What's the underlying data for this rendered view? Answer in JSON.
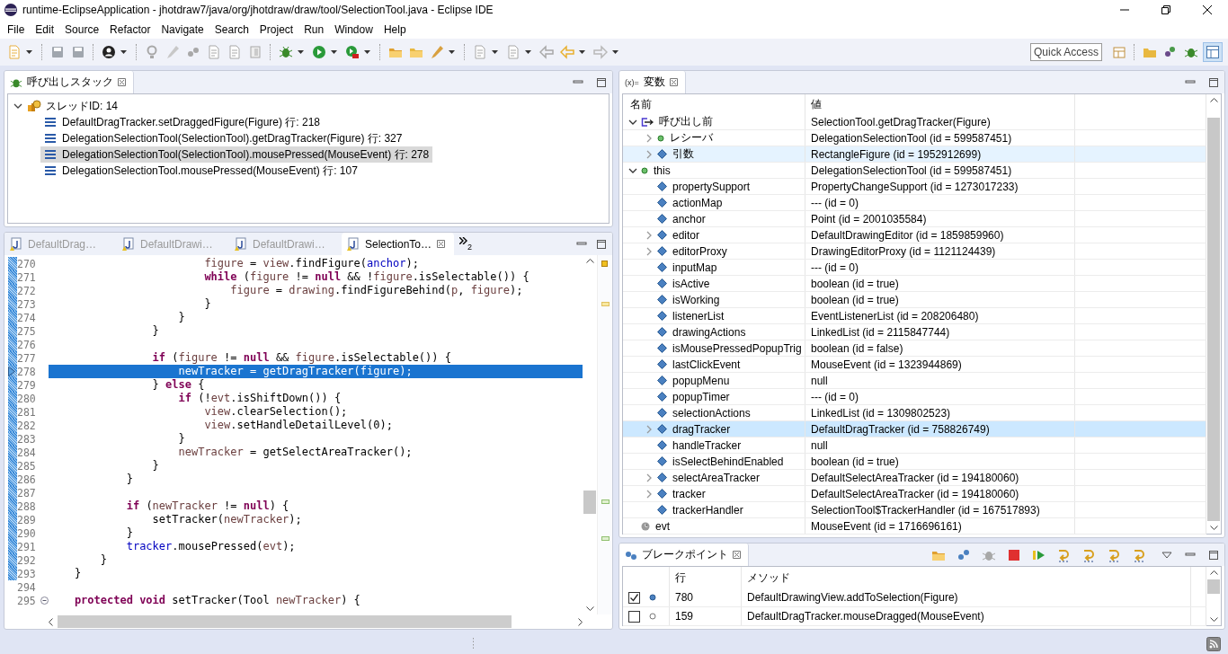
{
  "window": {
    "title": "runtime-EclipseApplication - jhotdraw7/java/org/jhotdraw/draw/tool/SelectionTool.java - Eclipse IDE"
  },
  "menu": [
    "File",
    "Edit",
    "Source",
    "Refactor",
    "Navigate",
    "Search",
    "Project",
    "Run",
    "Window",
    "Help"
  ],
  "quick_access": {
    "placeholder": "Quick Access"
  },
  "call_stack": {
    "title": "呼び出しスタック",
    "threads": [
      {
        "label": "スレッドID: 14",
        "expanded": true,
        "frames": [
          {
            "label": "DefaultDragTracker.setDraggedFigure(Figure) 行: 218",
            "selected": false
          },
          {
            "label": "DelegationSelectionTool(SelectionTool).getDragTracker(Figure) 行: 327",
            "selected": false
          },
          {
            "label": "DelegationSelectionTool(SelectionTool).mousePressed(MouseEvent) 行: 278",
            "selected": true
          },
          {
            "label": "DelegationSelectionTool.mousePressed(MouseEvent) 行: 107",
            "selected": false
          }
        ]
      }
    ]
  },
  "editor": {
    "tabs": [
      {
        "label": "DefaultDrag…",
        "selected": false
      },
      {
        "label": "DefaultDrawi…",
        "selected": false
      },
      {
        "label": "DefaultDrawi…",
        "selected": false
      },
      {
        "label": "SelectionTo…",
        "selected": true
      }
    ],
    "overflow": "2",
    "lines": [
      {
        "num": "270",
        "in_range": true,
        "tokens": [
          {
            "t": "                        figure",
            "kind": "local"
          },
          {
            "t": " = "
          },
          {
            "t": "view",
            "kind": "local"
          },
          {
            "t": ".findFigure("
          },
          {
            "t": "anchor",
            "kind": "field"
          },
          {
            "t": ");"
          }
        ]
      },
      {
        "num": "271",
        "in_range": true,
        "tokens": [
          {
            "t": "                        while",
            "kind": "keyword"
          },
          {
            "t": " ("
          },
          {
            "t": "figure",
            "kind": "local"
          },
          {
            "t": " != "
          },
          {
            "t": "null",
            "kind": "keyword"
          },
          {
            "t": " && !"
          },
          {
            "t": "figure",
            "kind": "local"
          },
          {
            "t": ".isSelectable()) {"
          }
        ]
      },
      {
        "num": "272",
        "in_range": true,
        "tokens": [
          {
            "t": "                            figure",
            "kind": "local"
          },
          {
            "t": " = "
          },
          {
            "t": "drawing",
            "kind": "local"
          },
          {
            "t": ".findFigureBehind("
          },
          {
            "t": "p",
            "kind": "local"
          },
          {
            "t": ", "
          },
          {
            "t": "figure",
            "kind": "local"
          },
          {
            "t": ");"
          }
        ]
      },
      {
        "num": "273",
        "in_range": true,
        "tokens": [
          {
            "t": "                        }"
          }
        ]
      },
      {
        "num": "274",
        "in_range": true,
        "tokens": [
          {
            "t": "                    }"
          }
        ]
      },
      {
        "num": "275",
        "in_range": true,
        "tokens": [
          {
            "t": "                }"
          }
        ]
      },
      {
        "num": "276",
        "in_range": true
      },
      {
        "num": "277",
        "in_range": true,
        "tokens": [
          {
            "t": "                if",
            "kind": "keyword"
          },
          {
            "t": " ("
          },
          {
            "t": "figure",
            "kind": "local"
          },
          {
            "t": " != "
          },
          {
            "t": "null",
            "kind": "keyword"
          },
          {
            "t": " && "
          },
          {
            "t": "figure",
            "kind": "local"
          },
          {
            "t": ".isSelectable()) {"
          }
        ]
      },
      {
        "num": "278",
        "in_range": true,
        "current": true,
        "tokens": [
          {
            "t": "                    newTracker",
            "kind": "local"
          },
          {
            "t": " = getDragTracker("
          },
          {
            "t": "figure",
            "kind": "local"
          },
          {
            "t": ");"
          }
        ]
      },
      {
        "num": "279",
        "in_range": true,
        "tokens": [
          {
            "t": "                } "
          },
          {
            "t": "else",
            "kind": "keyword"
          },
          {
            "t": " {"
          }
        ]
      },
      {
        "num": "280",
        "in_range": true,
        "tokens": [
          {
            "t": "                    if",
            "kind": "keyword"
          },
          {
            "t": " (!"
          },
          {
            "t": "evt",
            "kind": "local"
          },
          {
            "t": ".isShiftDown()) {"
          }
        ]
      },
      {
        "num": "281",
        "in_range": true,
        "tokens": [
          {
            "t": "                        view",
            "kind": "local"
          },
          {
            "t": ".clearSelection();"
          }
        ]
      },
      {
        "num": "282",
        "in_range": true,
        "tokens": [
          {
            "t": "                        view",
            "kind": "local"
          },
          {
            "t": ".setHandleDetailLevel(0);"
          }
        ]
      },
      {
        "num": "283",
        "in_range": true,
        "tokens": [
          {
            "t": "                    }"
          }
        ]
      },
      {
        "num": "284",
        "in_range": true,
        "tokens": [
          {
            "t": "                    newTracker",
            "kind": "local"
          },
          {
            "t": " = getSelectAreaTracker();"
          }
        ]
      },
      {
        "num": "285",
        "in_range": true,
        "tokens": [
          {
            "t": "                }"
          }
        ]
      },
      {
        "num": "286",
        "in_range": true,
        "tokens": [
          {
            "t": "            }"
          }
        ]
      },
      {
        "num": "287",
        "in_range": true
      },
      {
        "num": "288",
        "in_range": true,
        "tokens": [
          {
            "t": "            if",
            "kind": "keyword"
          },
          {
            "t": " ("
          },
          {
            "t": "newTracker",
            "kind": "local"
          },
          {
            "t": " != "
          },
          {
            "t": "null",
            "kind": "keyword"
          },
          {
            "t": ") {"
          }
        ]
      },
      {
        "num": "289",
        "in_range": true,
        "tokens": [
          {
            "t": "                setTracker("
          },
          {
            "t": "newTracker",
            "kind": "local"
          },
          {
            "t": ");"
          }
        ]
      },
      {
        "num": "290",
        "in_range": true,
        "tokens": [
          {
            "t": "            }"
          }
        ]
      },
      {
        "num": "291",
        "in_range": true,
        "tokens": [
          {
            "t": "            tracker",
            "kind": "field"
          },
          {
            "t": ".mousePressed("
          },
          {
            "t": "evt",
            "kind": "local"
          },
          {
            "t": ");"
          }
        ]
      },
      {
        "num": "292",
        "in_range": true,
        "tokens": [
          {
            "t": "        }"
          }
        ]
      },
      {
        "num": "293",
        "in_range": true,
        "tokens": [
          {
            "t": "    }"
          }
        ]
      },
      {
        "num": "294"
      },
      {
        "num": "295",
        "fold": true,
        "tokens": [
          {
            "t": "    protected void",
            "kind": "keyword"
          },
          {
            "t": " setTracker(Tool "
          },
          {
            "t": "newTracker",
            "kind": "local"
          },
          {
            "t": ") {"
          }
        ]
      }
    ]
  },
  "variables": {
    "title_icon": "(x)=",
    "title": "変数",
    "columns": [
      "名前",
      "値"
    ],
    "rows": [
      {
        "name": "呼び出し前",
        "value": "SelectionTool.getDragTracker(Figure)",
        "kind": "return",
        "expanded": true,
        "selected": false,
        "children": [
          {
            "name": "レシーバ",
            "value": "DelegationSelectionTool (id = 599587451)",
            "kind": "object",
            "expanded": false,
            "selected": false
          },
          {
            "name": "引数",
            "value": "RectangleFigure (id = 1952912699)",
            "kind": "field",
            "expanded": false,
            "selected": false,
            "hovered": true
          }
        ]
      },
      {
        "name": "this",
        "value": "DelegationSelectionTool (id = 599587451)",
        "kind": "object",
        "expanded": true,
        "selected": false,
        "children": [
          {
            "name": "propertySupport",
            "value": "PropertyChangeSupport (id = 1273017233)",
            "kind": "field",
            "selected": false
          },
          {
            "name": "actionMap",
            "value": "--- (id = 0)",
            "kind": "field",
            "selected": false
          },
          {
            "name": "anchor",
            "value": "Point (id = 2001035584)",
            "kind": "field",
            "selected": false
          },
          {
            "name": "editor",
            "value": "DefaultDrawingEditor (id = 1859859960)",
            "kind": "field",
            "expanded": false,
            "selected": false
          },
          {
            "name": "editorProxy",
            "value": "DrawingEditorProxy (id = 1121124439)",
            "kind": "field",
            "expanded": false,
            "selected": false
          },
          {
            "name": "inputMap",
            "value": "--- (id = 0)",
            "kind": "field",
            "selected": false
          },
          {
            "name": "isActive",
            "value": "boolean (id = true)",
            "kind": "field",
            "selected": false
          },
          {
            "name": "isWorking",
            "value": "boolean (id = true)",
            "kind": "field",
            "selected": false
          },
          {
            "name": "listenerList",
            "value": "EventListenerList (id = 208206480)",
            "kind": "field",
            "selected": false
          },
          {
            "name": "drawingActions",
            "value": "LinkedList (id = 2115847744)",
            "kind": "field",
            "selected": false
          },
          {
            "name": "isMousePressedPopupTrig",
            "value": "boolean (id = false)",
            "kind": "field",
            "selected": false
          },
          {
            "name": "lastClickEvent",
            "value": "MouseEvent (id = 1323944869)",
            "kind": "field",
            "selected": false
          },
          {
            "name": "popupMenu",
            "value": "null",
            "kind": "field",
            "selected": false
          },
          {
            "name": "popupTimer",
            "value": "--- (id = 0)",
            "kind": "field",
            "selected": false
          },
          {
            "name": "selectionActions",
            "value": "LinkedList (id = 1309802523)",
            "kind": "field",
            "selected": false
          },
          {
            "name": "dragTracker",
            "value": "DefaultDragTracker (id = 758826749)",
            "kind": "field",
            "expanded": false,
            "selected": true
          },
          {
            "name": "handleTracker",
            "value": "null",
            "kind": "field",
            "selected": false
          },
          {
            "name": "isSelectBehindEnabled",
            "value": "boolean (id = true)",
            "kind": "field",
            "selected": false
          },
          {
            "name": "selectAreaTracker",
            "value": "DefaultSelectAreaTracker (id = 194180060)",
            "kind": "field",
            "expanded": false,
            "selected": false
          },
          {
            "name": "tracker",
            "value": "DefaultSelectAreaTracker (id = 194180060)",
            "kind": "field",
            "expanded": false,
            "selected": false
          },
          {
            "name": "trackerHandler",
            "value": "SelectionTool$TrackerHandler (id = 167517893)",
            "kind": "field",
            "selected": false
          }
        ]
      },
      {
        "name": "evt",
        "value": "MouseEvent (id = 1716696161)",
        "kind": "local",
        "selected": false
      }
    ]
  },
  "breakpoints": {
    "title": "ブレークポイント",
    "columns": [
      "行",
      "メソッド"
    ],
    "rows": [
      {
        "checked": true,
        "line": "780",
        "method": "DefaultDrawingView.addToSelection(Figure)"
      },
      {
        "checked": false,
        "line": "159",
        "method": "DefaultDragTracker.mouseDragged(MouseEvent)"
      }
    ]
  }
}
